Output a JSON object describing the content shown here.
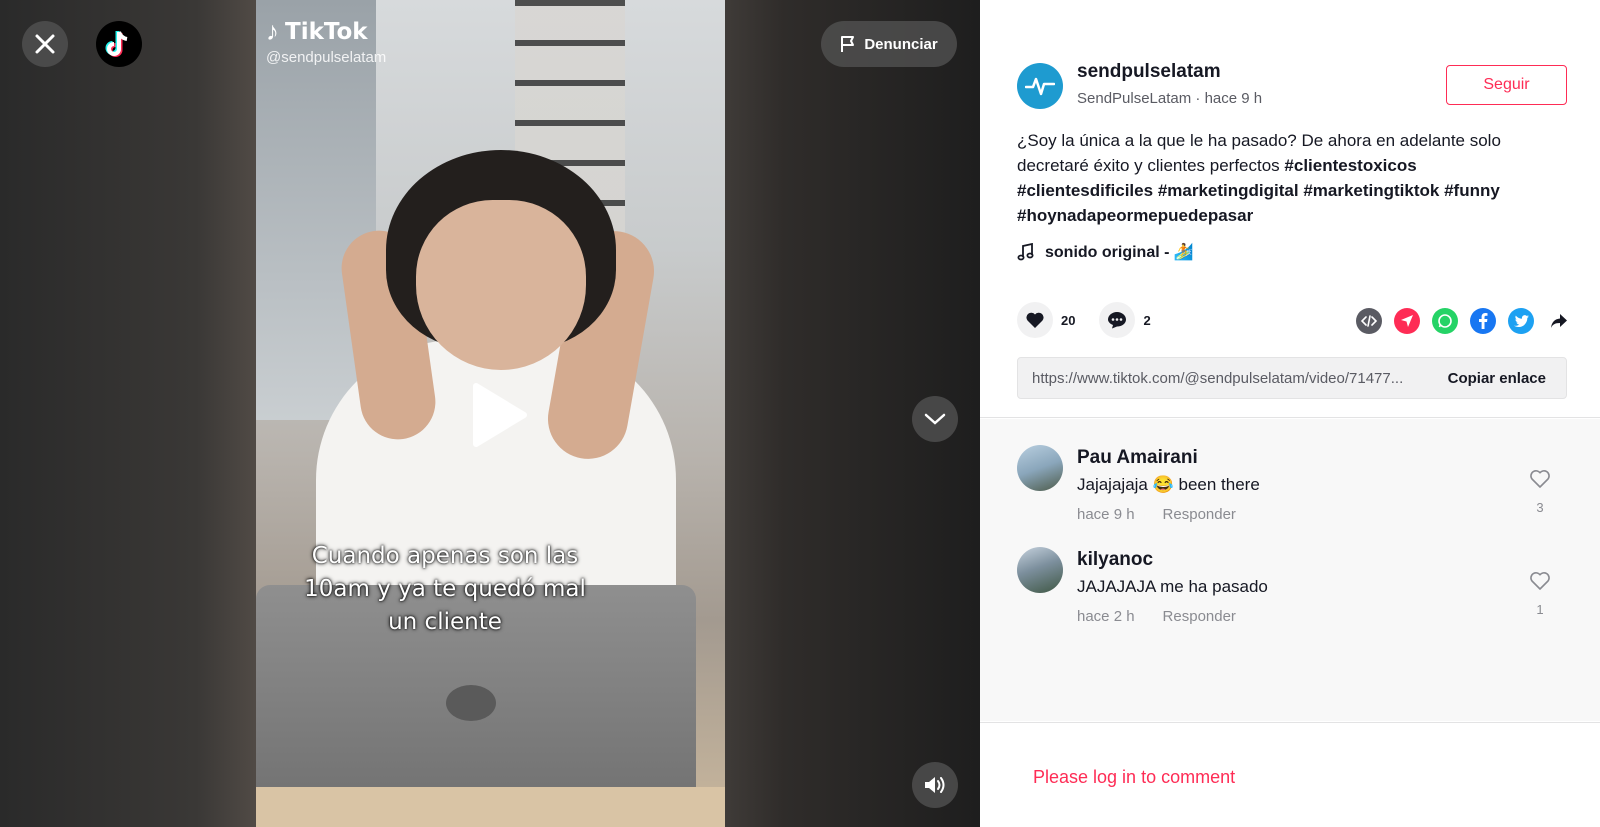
{
  "video": {
    "watermark_name": "TikTok",
    "watermark_handle": "@sendpulselatam",
    "caption": "Cuando apenas son las 10am y ya te quedó mal un cliente",
    "report_label": "Denunciar"
  },
  "author": {
    "uid": "sendpulselatam",
    "nickname": "SendPulseLatam",
    "separator": " · ",
    "time": "hace 9 h",
    "follow_label": "Seguir"
  },
  "description": {
    "text": "¿Soy la única a la que le ha pasado? De ahora en adelante solo decretaré éxito y clientes perfectos ",
    "hashtags": [
      "#clientestoxicos",
      "#clientesdificiles",
      "#marketingdigital",
      "#marketingtiktok",
      "#funny",
      "#hoynadapeormepuedepasar"
    ]
  },
  "music": {
    "title": "sonido original - 🏄"
  },
  "stats": {
    "likes": "20",
    "comments": "2"
  },
  "link": {
    "url": "https://www.tiktok.com/@sendpulselatam/video/71477...",
    "copy_label": "Copiar enlace"
  },
  "comments": [
    {
      "user": "Pau Amairani",
      "text": "Jajajajaja 😂 been there",
      "time": "hace 9 h",
      "reply_label": "Responder",
      "likes": "3"
    },
    {
      "user": "kilyanoc",
      "text": "JAJAJAJA me ha pasado",
      "time": "hace 2 h",
      "reply_label": "Responder",
      "likes": "1"
    }
  ],
  "login": {
    "text": "Please log in to comment"
  },
  "colors": {
    "accent": "#fe2c55",
    "text_primary": "#161823",
    "text_secondary": "#8a8b91"
  }
}
